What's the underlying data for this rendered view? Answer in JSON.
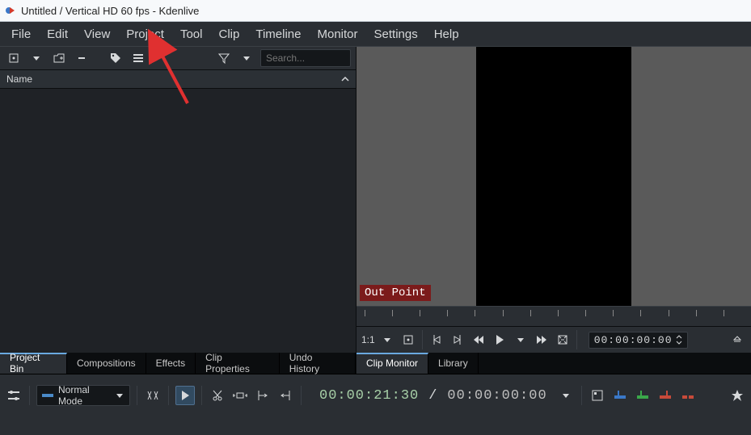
{
  "window": {
    "title": "Untitled / Vertical HD 60 fps - Kdenlive"
  },
  "menu": {
    "items": [
      "File",
      "Edit",
      "View",
      "Project",
      "Tool",
      "Clip",
      "Timeline",
      "Monitor",
      "Settings",
      "Help"
    ]
  },
  "bin": {
    "search_placeholder": "Search...",
    "header": "Name"
  },
  "left_tabs": [
    "Project Bin",
    "Compositions",
    "Effects",
    "Clip Properties",
    "Undo History"
  ],
  "monitor": {
    "out_label": "Out Point",
    "scale_label": "1:1",
    "timecode": "00:00:00:00"
  },
  "right_tabs": [
    "Clip Monitor",
    "Library"
  ],
  "bottom": {
    "mode": "Normal Mode",
    "timecode_pos": "00:00:21:30",
    "timecode_sep": "/",
    "timecode_dur": "00:00:00:00"
  }
}
